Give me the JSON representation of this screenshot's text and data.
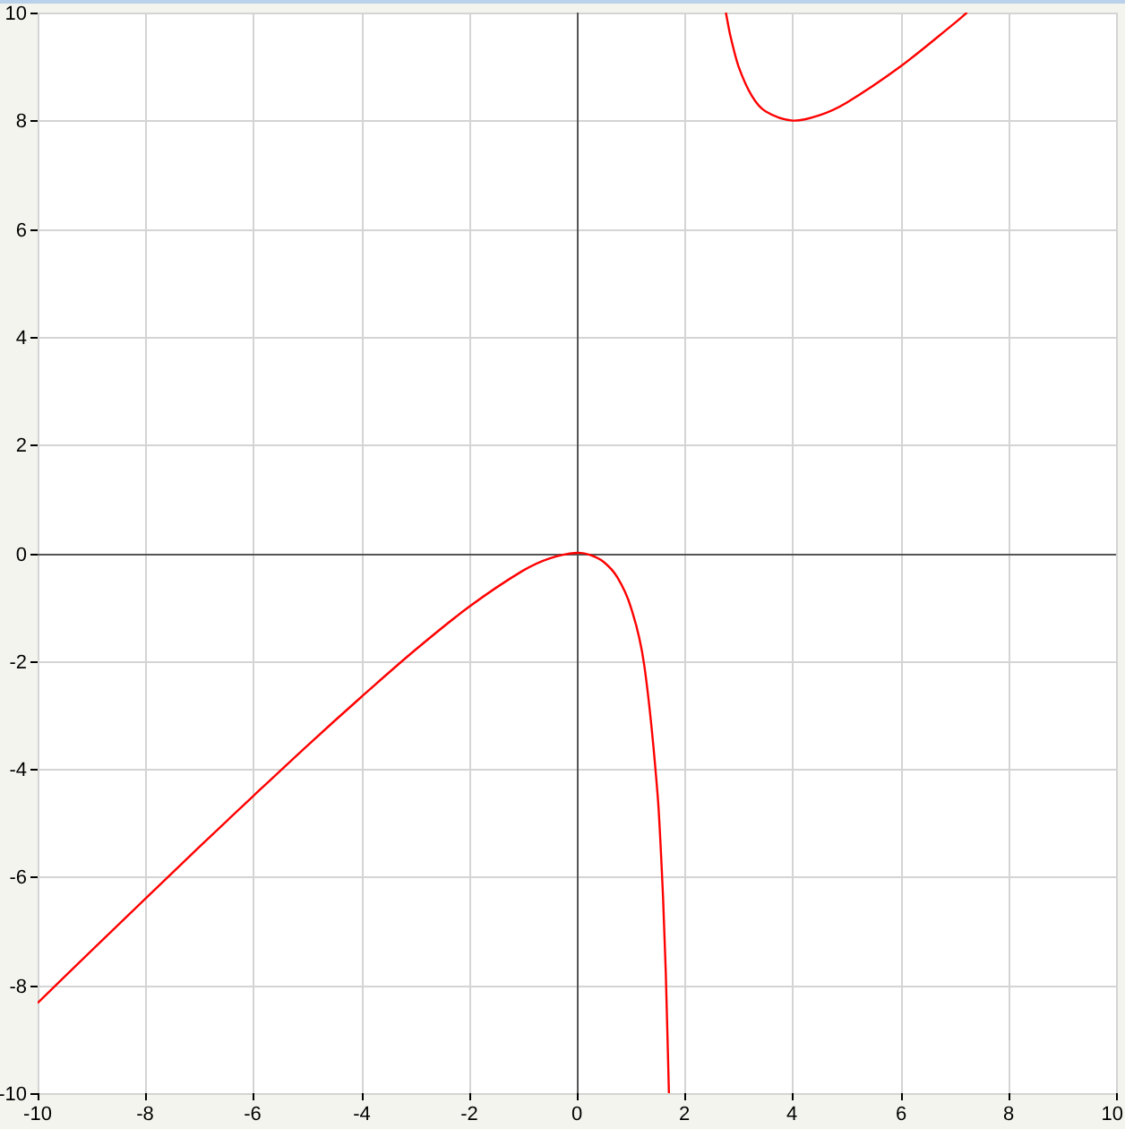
{
  "chart_data": {
    "type": "line",
    "grid": true,
    "x": [
      -10,
      -9,
      -8,
      -7,
      -6,
      -5,
      -4,
      -3,
      -2,
      -1,
      -0.5,
      0,
      0.25,
      0.5,
      0.75,
      1,
      1.25,
      1.5,
      1.6,
      1.65,
      1.708,
      2,
      2.764,
      2.85,
      3,
      3.25,
      3.5,
      4,
      4.5,
      5,
      6,
      7,
      7.236
    ],
    "series": [
      {
        "color": "#ff0000",
        "values": [
          -8.33,
          -7.36,
          -6.4,
          -5.44,
          -4.5,
          -3.57,
          -2.67,
          -1.8,
          -1,
          -0.33,
          -0.1,
          0,
          -0.04,
          -0.17,
          -0.45,
          -1,
          -2.08,
          -4.5,
          -6.4,
          -7.78,
          -10,
          null,
          10,
          9.56,
          9,
          8.45,
          8.17,
          8,
          8.1,
          8.33,
          9,
          9.8,
          10
        ]
      }
    ],
    "xlim": [
      -10,
      10
    ],
    "ylim": [
      -10,
      10
    ],
    "xticks": [
      -10,
      -8,
      -6,
      -4,
      -2,
      0,
      2,
      4,
      6,
      8,
      10
    ],
    "yticks": [
      -10,
      -8,
      -6,
      -4,
      -2,
      0,
      2,
      4,
      6,
      8,
      10
    ]
  }
}
